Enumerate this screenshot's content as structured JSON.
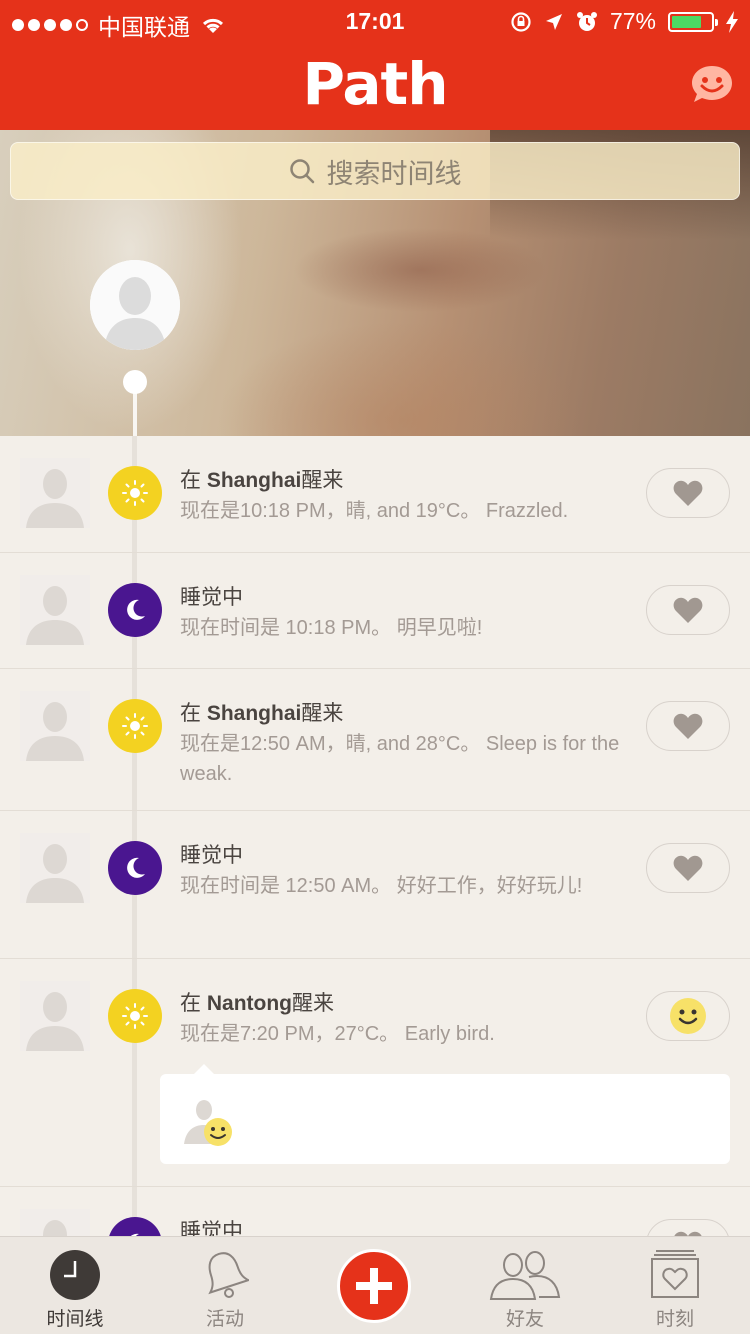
{
  "status_bar": {
    "carrier": "中国联通",
    "time": "17:01",
    "battery": "77%",
    "battery_level": 0.77
  },
  "nav": {
    "title": "Path"
  },
  "search": {
    "placeholder": "搜索时间线"
  },
  "feed": {
    "items": [
      {
        "icon": "sun-icon",
        "title_prefix": "在 ",
        "place": "Shanghai",
        "title_suffix": "醒来",
        "subtitle": "现在是10:18 PM，晴, and 19°C。 Frazzled.",
        "reaction": "heart"
      },
      {
        "icon": "moon-icon",
        "title_prefix": "睡觉中",
        "place": "",
        "title_suffix": "",
        "subtitle": "现在时间是 10:18 PM。 明早见啦!",
        "reaction": "heart"
      },
      {
        "icon": "sun-icon",
        "title_prefix": "在 ",
        "place": "Shanghai",
        "title_suffix": "醒来",
        "subtitle": "现在是12:50 AM，晴, and 28°C。 Sleep is for the weak.",
        "reaction": "heart"
      },
      {
        "icon": "moon-icon",
        "title_prefix": "睡觉中",
        "place": "",
        "title_suffix": "",
        "subtitle": "现在时间是 12:50 AM。 好好工作，好好玩儿!",
        "reaction": "heart"
      },
      {
        "icon": "sun-icon",
        "title_prefix": "在 ",
        "place": "Nantong",
        "title_suffix": "醒来",
        "subtitle": "现在是7:20 PM，27°C。 Early bird.",
        "reaction": "smile"
      },
      {
        "icon": "moon-icon",
        "title_prefix": "睡觉中",
        "place": "",
        "title_suffix": "",
        "subtitle": "",
        "reaction": "heart"
      }
    ]
  },
  "tabbar": {
    "tabs": [
      {
        "label": "时间线",
        "icon": "clock-icon",
        "active": true
      },
      {
        "label": "活动",
        "icon": "bell-icon",
        "active": false
      },
      {
        "label": "",
        "icon": "plus-icon",
        "active": false
      },
      {
        "label": "好友",
        "icon": "friends-icon",
        "active": false
      },
      {
        "label": "时刻",
        "icon": "moments-icon",
        "active": false
      }
    ]
  },
  "colors": {
    "brand": "#e5321a",
    "sun": "#f3d221",
    "moon": "#4a1690",
    "background": "#f3efe9"
  }
}
